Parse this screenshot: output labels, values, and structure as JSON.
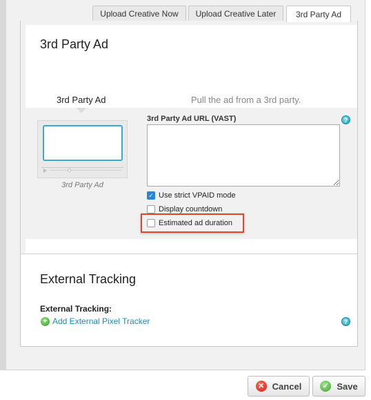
{
  "tabs": [
    {
      "label": "Upload Creative Now",
      "active": false
    },
    {
      "label": "Upload Creative Later",
      "active": false
    },
    {
      "label": "3rd Party Ad",
      "active": true
    }
  ],
  "section": {
    "title": "3rd Party Ad",
    "option_label": "3rd Party Ad",
    "option_description": "Pull the ad from a 3rd party.",
    "thumbnail_caption": "3rd Party Ad"
  },
  "vast": {
    "field_label": "3rd Party Ad URL (VAST)",
    "value": "",
    "help_icon": "question-icon"
  },
  "checkboxes": [
    {
      "label": "Use strict VPAID mode",
      "checked": true
    },
    {
      "label": "Display countdown",
      "checked": false
    },
    {
      "label": "Estimated ad duration",
      "checked": false
    }
  ],
  "external_tracking": {
    "title": "External Tracking",
    "field_label": "External Tracking:",
    "add_link": "Add External Pixel Tracker",
    "help_icon": "question-icon"
  },
  "footer": {
    "cancel_label": "Cancel",
    "save_label": "Save"
  },
  "colors": {
    "accent": "#39a9d2",
    "highlight": "#e2452b",
    "link": "#1d8fb5",
    "checkbox_checked": "#2a86d4"
  }
}
